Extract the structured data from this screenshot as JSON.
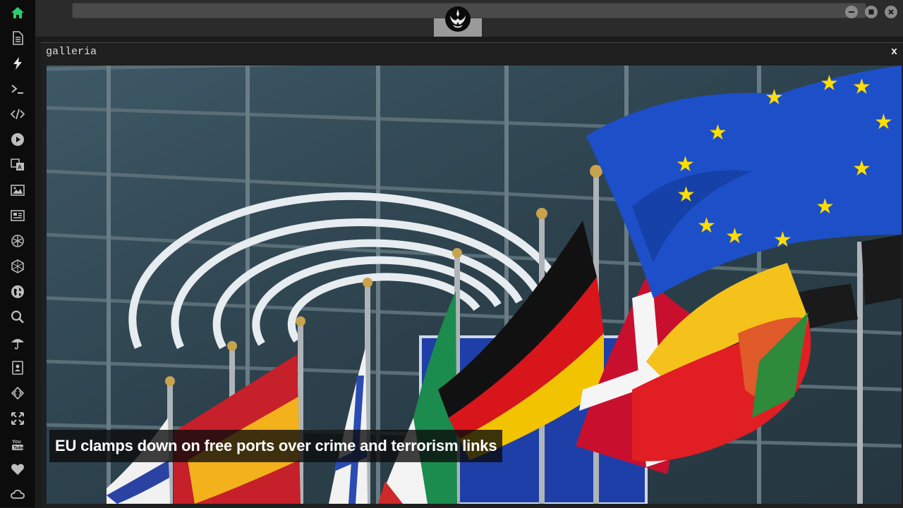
{
  "panel": {
    "title": "galleria",
    "close_label": "x"
  },
  "gallery": {
    "caption": "EU clamps down on free ports over crime and terrorism links"
  },
  "sidebar": {
    "items": [
      {
        "icon": "home-icon",
        "active": true
      },
      {
        "icon": "document-icon"
      },
      {
        "icon": "lightning-icon"
      },
      {
        "icon": "terminal-icon"
      },
      {
        "icon": "code-icon"
      },
      {
        "icon": "play-icon"
      },
      {
        "icon": "translate-icon"
      },
      {
        "icon": "image-icon"
      },
      {
        "icon": "newspaper-icon"
      },
      {
        "icon": "rebel-icon"
      },
      {
        "icon": "empire-icon"
      },
      {
        "icon": "globe-icon"
      },
      {
        "icon": "search-icon"
      },
      {
        "icon": "umbrella-icon"
      },
      {
        "icon": "contact-book-icon"
      },
      {
        "icon": "dev-icon"
      },
      {
        "icon": "expand-icon"
      },
      {
        "icon": "youtube-icon"
      },
      {
        "icon": "heart-icon"
      },
      {
        "icon": "cloud-icon"
      }
    ]
  },
  "window_controls": [
    "minimize-icon",
    "maximize-icon",
    "close-icon"
  ],
  "colors": {
    "accent_active": "#2ecc71",
    "icon": "#bdbdbd",
    "sidebar_bg": "#0c0c0c",
    "topbar_bg": "#2b2b2b"
  }
}
